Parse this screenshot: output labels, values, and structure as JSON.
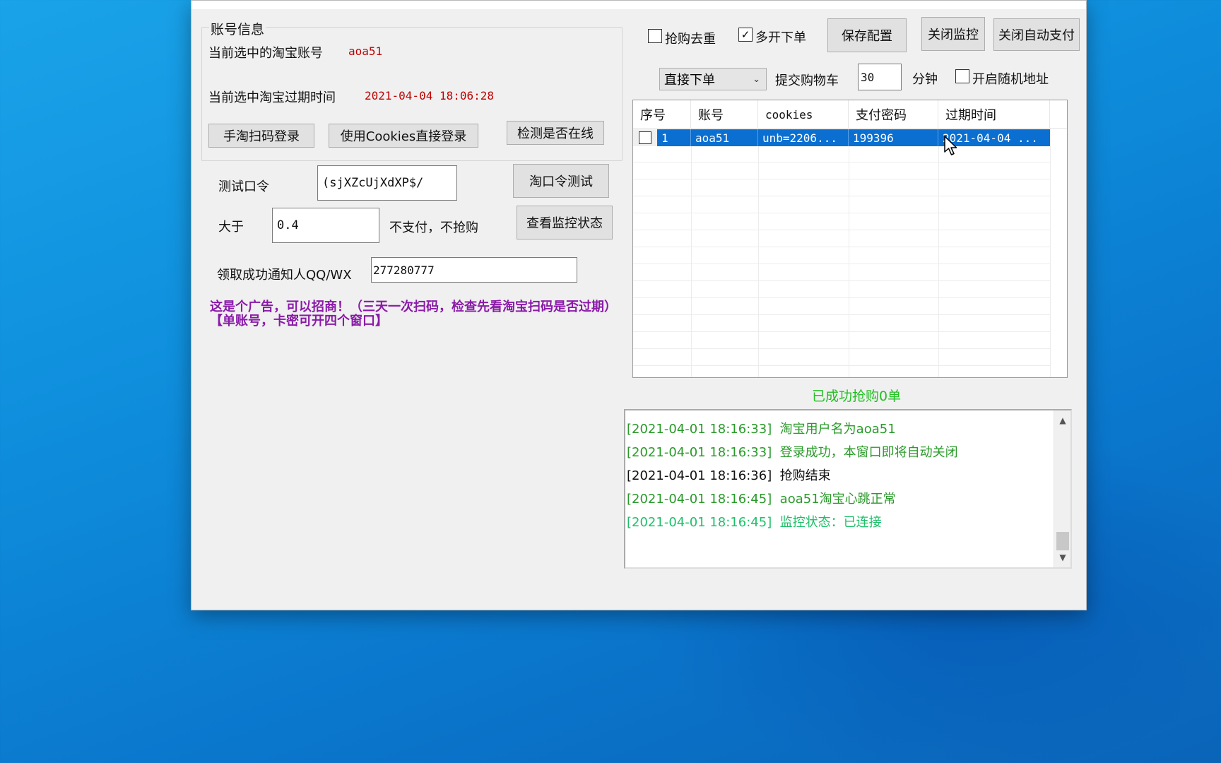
{
  "account_group": {
    "title": "账号信息",
    "current_account_label": "当前选中的淘宝账号",
    "current_account_value": "aoa51",
    "expiry_label": "当前选中淘宝过期时间",
    "expiry_value": "2021-04-04 18:06:28",
    "scan_login_button": "手淘扫码登录",
    "cookies_login_button": "使用Cookies直接登录",
    "check_online_button": "检测是否在线"
  },
  "test_command": {
    "label": "测试口令",
    "value": "(sjXZcUjXdXP$/",
    "button": "淘口令测试"
  },
  "threshold": {
    "label": "大于",
    "value": "0.4",
    "suffix": "不支付，不抢购",
    "button": "查看监控状态"
  },
  "notify": {
    "label": "领取成功通知人QQ/WX",
    "value": "277280777"
  },
  "ad_text": "这是个广告，可以招商！（三天一次扫码，检查先看淘宝扫码是否过期）【单账号，卡密可开四个窗口】",
  "toolbar": {
    "dedupe_label": "抢购去重",
    "dedupe_checked": false,
    "multi_label": "多开下单",
    "multi_checked": true,
    "save_button": "保存配置",
    "close_monitor_button": "关闭监控",
    "close_autopay_button": "关闭自动支付",
    "order_mode_selected": "直接下单",
    "cart_label": "提交购物车",
    "minutes_value": "30",
    "minutes_unit": "分钟",
    "random_addr_label": "开启随机地址",
    "random_addr_checked": false
  },
  "table": {
    "headers": [
      "序号",
      "账号",
      "cookies",
      "支付密码",
      "过期时间"
    ],
    "rows": [
      {
        "index": "1",
        "account": "aoa51",
        "cookies": "unb=2206...",
        "password": "199396",
        "expiry": "2021-04-04 ..."
      }
    ]
  },
  "status_text": "已成功抢购0单",
  "log": [
    {
      "time": "[2021-04-01 18:16:33]",
      "msg": "淘宝用户名为aoa51",
      "color": "#2a9a2a"
    },
    {
      "time": "[2021-04-01 18:16:33]",
      "msg": "登录成功，本窗口即将自动关闭",
      "color": "#2a9a2a"
    },
    {
      "time": "[2021-04-01 18:16:36]",
      "msg": "抢购结束",
      "color": "#111111"
    },
    {
      "time": "[2021-04-01 18:16:45]",
      "msg": "aoa51淘宝心跳正常",
      "color": "#2a9a2a"
    },
    {
      "time": "[2021-04-01 18:16:45]",
      "msg": "监控状态：已连接",
      "color": "#1fbf6a"
    }
  ],
  "icons": {
    "dropdown": "chevron-down-icon",
    "scroll_up": "scroll-up-icon",
    "scroll_down": "scroll-down-icon",
    "cursor": "mouse-pointer-icon"
  },
  "colors": {
    "desktop": "#0f8fdd",
    "selected_row": "#0a6fd1",
    "ad": "#8a1aa8",
    "success": "#22c022",
    "red_value": "#c00000"
  }
}
